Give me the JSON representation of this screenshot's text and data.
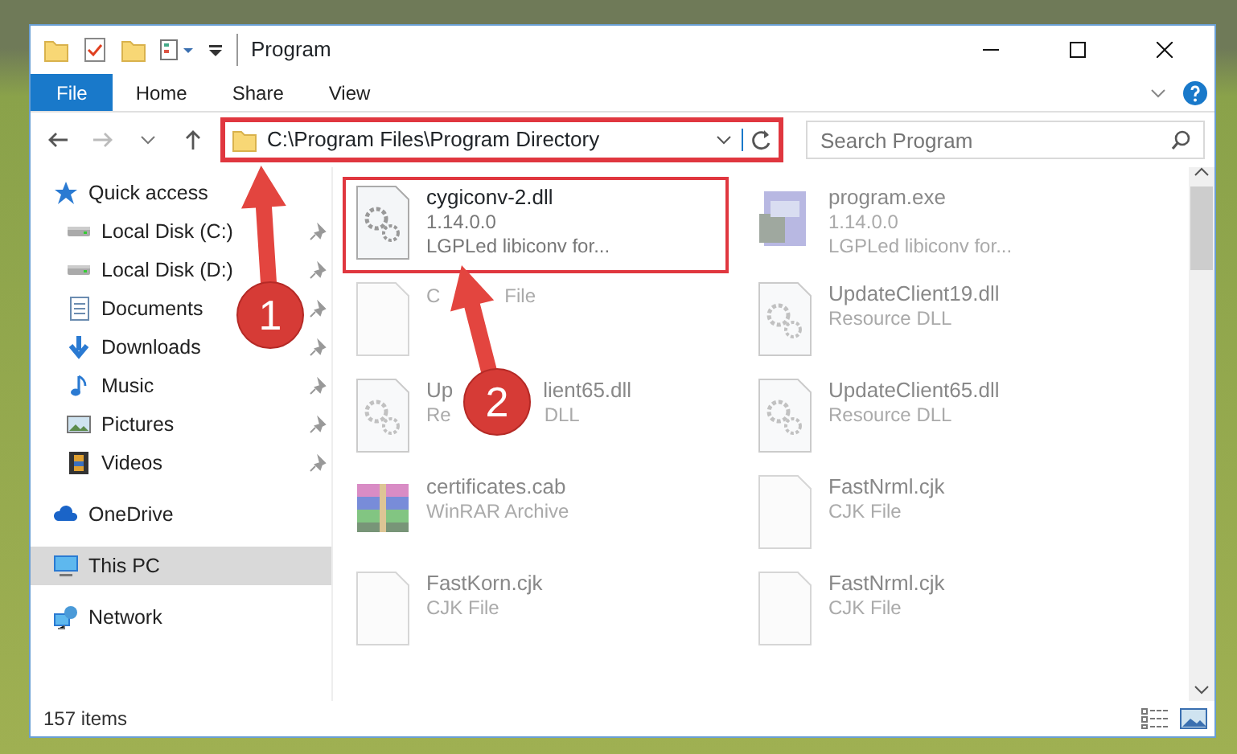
{
  "window": {
    "title": "Program"
  },
  "ribbon_tabs": [
    {
      "label": "File",
      "selected": true
    },
    {
      "label": "Home",
      "selected": false
    },
    {
      "label": "Share",
      "selected": false
    },
    {
      "label": "View",
      "selected": false
    }
  ],
  "address_bar": {
    "path": "C:\\Program Files\\Program Directory",
    "highlighted": true
  },
  "search": {
    "placeholder": "Search Program"
  },
  "sidebar": {
    "items": [
      {
        "label": "Quick access",
        "kind": "star",
        "selected": false,
        "children": [
          {
            "label": "Local Disk (C:)",
            "kind": "drive",
            "selected": false,
            "pinned": true
          },
          {
            "label": "Local Disk (D:)",
            "kind": "drive",
            "selected": false,
            "pinned": true
          },
          {
            "label": "Documents",
            "kind": "document",
            "selected": false,
            "pinned": true
          },
          {
            "label": "Downloads",
            "kind": "download",
            "selected": false,
            "pinned": true
          },
          {
            "label": "Music",
            "kind": "music",
            "selected": false,
            "pinned": true
          },
          {
            "label": "Pictures",
            "kind": "pictures",
            "selected": false,
            "pinned": true
          },
          {
            "label": "Videos",
            "kind": "videos",
            "selected": false,
            "pinned": true
          }
        ]
      },
      {
        "label": "OneDrive",
        "kind": "cloud",
        "selected": false
      },
      {
        "label": "This PC",
        "kind": "computer",
        "selected": true
      },
      {
        "label": "Network",
        "kind": "network",
        "selected": false
      }
    ]
  },
  "files": [
    {
      "name": [
        "cygiconv-2.dll"
      ],
      "details": [
        [
          "1.14.0.0"
        ],
        [
          "LGPLed libiconv for..."
        ]
      ],
      "kind": "dll",
      "blurred": false,
      "highlighted": true
    },
    {
      "name": [
        "program.exe"
      ],
      "details": [
        [
          "1.14.0.0"
        ],
        [
          "LGPLed libiconv for..."
        ]
      ],
      "kind": "exe",
      "blurred": true,
      "highlighted": false
    },
    {
      "details": [
        [
          "C",
          "File"
        ]
      ],
      "kind": "blank",
      "blurred": true,
      "highlighted": false
    },
    {
      "name": [
        "UpdateClient19.dll"
      ],
      "details": [
        [
          "Resource DLL"
        ]
      ],
      "kind": "dll",
      "blurred": true,
      "highlighted": false
    },
    {
      "name": [
        "Up",
        "lient65.dll"
      ],
      "details": [
        [
          "Re",
          "DLL"
        ]
      ],
      "kind": "dll",
      "blurred": true,
      "highlighted": false
    },
    {
      "name": [
        "UpdateClient65.dll"
      ],
      "details": [
        [
          "Resource DLL"
        ]
      ],
      "kind": "dll",
      "blurred": true,
      "highlighted": false
    },
    {
      "name": [
        "certificates.cab"
      ],
      "details": [
        [
          "WinRAR Archive"
        ]
      ],
      "kind": "rar",
      "blurred": true,
      "highlighted": false
    },
    {
      "name": [
        "FastNrml.cjk"
      ],
      "details": [
        [
          "CJK File"
        ]
      ],
      "kind": "blank",
      "blurred": true,
      "highlighted": false
    },
    {
      "name": [
        "FastKorn.cjk"
      ],
      "details": [
        [
          "CJK File"
        ]
      ],
      "kind": "blank",
      "blurred": true,
      "highlighted": false
    },
    {
      "name": [
        "FastNrml.cjk"
      ],
      "details": [
        [
          "CJK File"
        ]
      ],
      "kind": "blank",
      "blurred": true,
      "highlighted": false
    }
  ],
  "status_bar": {
    "count": "157 items"
  },
  "annotations": [
    {
      "label": "1"
    },
    {
      "label": "2"
    }
  ]
}
